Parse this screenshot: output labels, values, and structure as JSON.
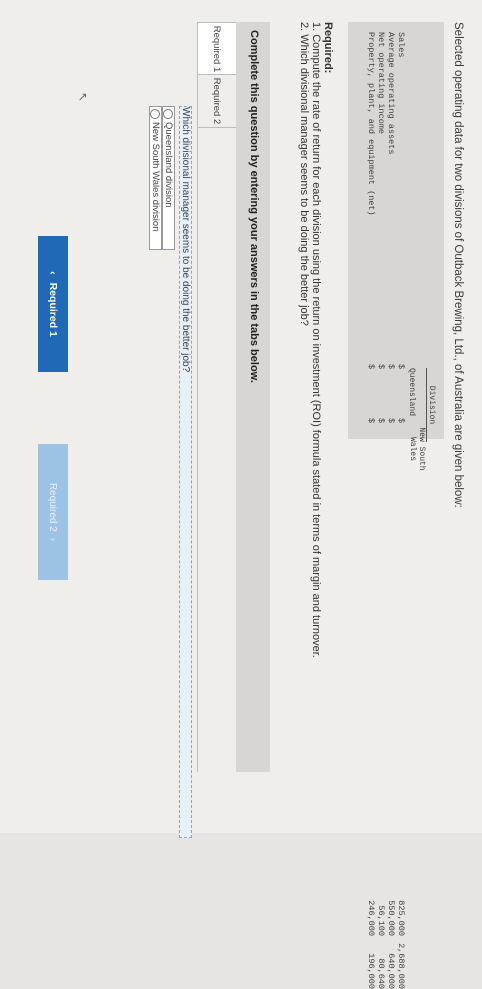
{
  "intro": "Selected operating data for two divisions of Outback Brewing, Ltd., of Australia are given below:",
  "table": {
    "division_header": "Division",
    "col1": "Queensland",
    "col2_line1": "New South",
    "col2_line2": "Wales",
    "rows": [
      {
        "label": "Sales",
        "c1": "$",
        "v1": "825,000",
        "c2": "$",
        "v2": "2,688,000"
      },
      {
        "label": "Average operating assets",
        "c1": "$",
        "v1": "550,000",
        "c2": "$",
        "v2": "640,000"
      },
      {
        "label": "Net operating income",
        "c1": "$",
        "v1": "56,100",
        "c2": "$",
        "v2": "80,640"
      },
      {
        "label": "Property, plant, and equipment (net)",
        "c1": "$",
        "v1": "246,000",
        "c2": "$",
        "v2": "196,000"
      }
    ]
  },
  "required": {
    "title": "Required:",
    "line1": "1. Compute the rate of return for each division using the return on investment (ROI) formula stated in terms of margin and turnover.",
    "line2": "2. Which divisional manager seems to be doing the better job?"
  },
  "complete_text": "Complete this question by entering your answers in the tabs below.",
  "tabs": [
    "Required 1",
    "Required 2"
  ],
  "question": "Which divisional manager seems to be doing the better job?",
  "options": [
    "Queensland division",
    "New South Wales division"
  ],
  "buttons": {
    "prev": "Required 1",
    "next": "Required 2"
  }
}
